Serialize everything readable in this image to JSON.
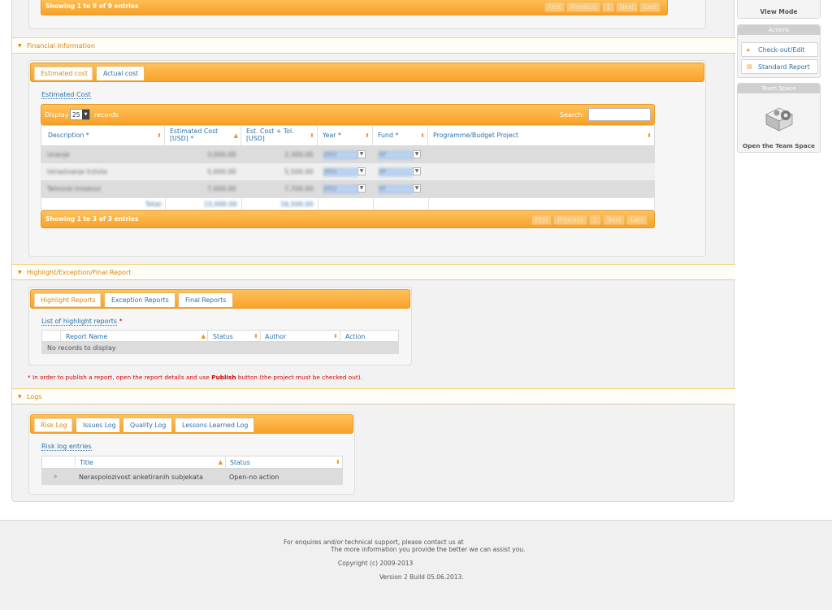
{
  "top_table": {
    "showing": "Showing 1 to 9 of 9 entries",
    "pager": [
      "First",
      "Previous",
      "1",
      "Next",
      "Last"
    ]
  },
  "sidebar": {
    "view_mode": "View Mode",
    "actions_title": "Actions",
    "checkout": "Check-out/Edit",
    "standard_report": "Standard Report",
    "team_space_title": "Team Space",
    "open_team_space": "Open the Team Space"
  },
  "financial": {
    "title": "Financial Information",
    "tabs": [
      "Estimated cost",
      "Actual cost"
    ],
    "sublink": "Estimated Cost",
    "display_label": "Display",
    "display_value": "25",
    "records_label": "records",
    "search_label": "Search:",
    "columns": [
      "Description *",
      "Estimated Cost [USD] *",
      "Est. Cost + Tol. [USD]",
      "Year *",
      "Fund *",
      "Programme/Budget Project"
    ],
    "rows": [
      {
        "desc": "Ucenje",
        "est": "3,000.00",
        "tol": "3,300.00",
        "year": "2012",
        "fund": "GF"
      },
      {
        "desc": "Istrazivanje trzista",
        "est": "5,000.00",
        "tol": "5,500.00",
        "year": "2012",
        "fund": "GF"
      },
      {
        "desc": "Tehnicki troskovi",
        "est": "7,000.00",
        "tol": "7,700.00",
        "year": "2012",
        "fund": "GF"
      }
    ],
    "total_label": "Total:",
    "total_est": "15,000.00",
    "total_tol": "16,500.00",
    "showing": "Showing 1 to 3 of 3 entries",
    "pager": [
      "First",
      "Previous",
      "1",
      "Next",
      "Last"
    ]
  },
  "reports": {
    "title": "Highlight/Exception/Final Report",
    "tabs": [
      "Highlight Reports",
      "Exception Reports",
      "Final Reports"
    ],
    "sublink": "List of highlight reports",
    "req": "*",
    "columns": [
      "Report Name",
      "Status",
      "Author",
      "Action"
    ],
    "empty": "No records to display",
    "note_prefix": "* In order to publish a report, open the report details and use ",
    "note_bold": "Publish",
    "note_suffix": " button (the project must be checked out)."
  },
  "logs": {
    "title": "Logs",
    "tabs": [
      "Risk Log",
      "Issues Log",
      "Quality Log",
      "Lessons Learned Log"
    ],
    "sublink": "Risk log entries",
    "columns": [
      "Title",
      "Status"
    ],
    "rows": [
      {
        "title": "Neraspolozivost anketiranih subjekata",
        "status": "Open-no action"
      }
    ]
  },
  "footer": {
    "line1": "For enquires and/or technical support, please contact us at",
    "line2": "The more information you provide the better we can assist you.",
    "copyright": "Copyright (c) 2009-2013",
    "version": "Version 2 Build 05.06.2013."
  }
}
